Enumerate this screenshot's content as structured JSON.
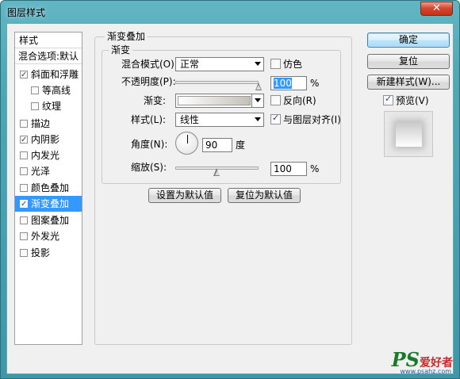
{
  "window": {
    "title": "图层样式",
    "close_glyph": "✕"
  },
  "style_list": {
    "header": "样式",
    "blend_options": "混合选项:默认",
    "items": [
      {
        "label": "斜面和浮雕",
        "checked": true
      },
      {
        "label": "等高线",
        "checked": false
      },
      {
        "label": "纹理",
        "checked": false
      },
      {
        "label": "描边",
        "checked": false
      },
      {
        "label": "内阴影",
        "checked": true
      },
      {
        "label": "内发光",
        "checked": false
      },
      {
        "label": "光泽",
        "checked": false
      },
      {
        "label": "颜色叠加",
        "checked": false
      },
      {
        "label": "渐变叠加",
        "checked": true,
        "selected": true
      },
      {
        "label": "图案叠加",
        "checked": false
      },
      {
        "label": "外发光",
        "checked": false
      },
      {
        "label": "投影",
        "checked": false
      }
    ]
  },
  "panel": {
    "title": "渐变叠加",
    "group_title": "渐变",
    "blend_mode_label": "混合模式(O):",
    "blend_mode_value": "正常",
    "dither_label": "仿色",
    "dither_checked": false,
    "opacity_label": "不透明度(P):",
    "opacity_value": "100",
    "percent": "%",
    "gradient_label": "渐变:",
    "reverse_label": "反向(R)",
    "reverse_checked": false,
    "style_label": "样式(L):",
    "style_value": "线性",
    "align_label": "与图层对齐(I)",
    "align_checked": true,
    "angle_label": "角度(N):",
    "angle_value": "90",
    "degree_unit": "度",
    "scale_label": "缩放(S):",
    "scale_value": "100",
    "set_default_btn": "设置为默认值",
    "reset_default_btn": "复位为默认值",
    "opacity_level": 1.0,
    "scale_level": 0.5
  },
  "side_buttons": {
    "ok": "确定",
    "reset": "复位",
    "new_style": "新建样式(W)...",
    "preview_label": "预览(V)",
    "preview_checked": true
  },
  "watermark": {
    "ps": "PS",
    "cn": "爱好者",
    "url": "www.psahz.com"
  }
}
